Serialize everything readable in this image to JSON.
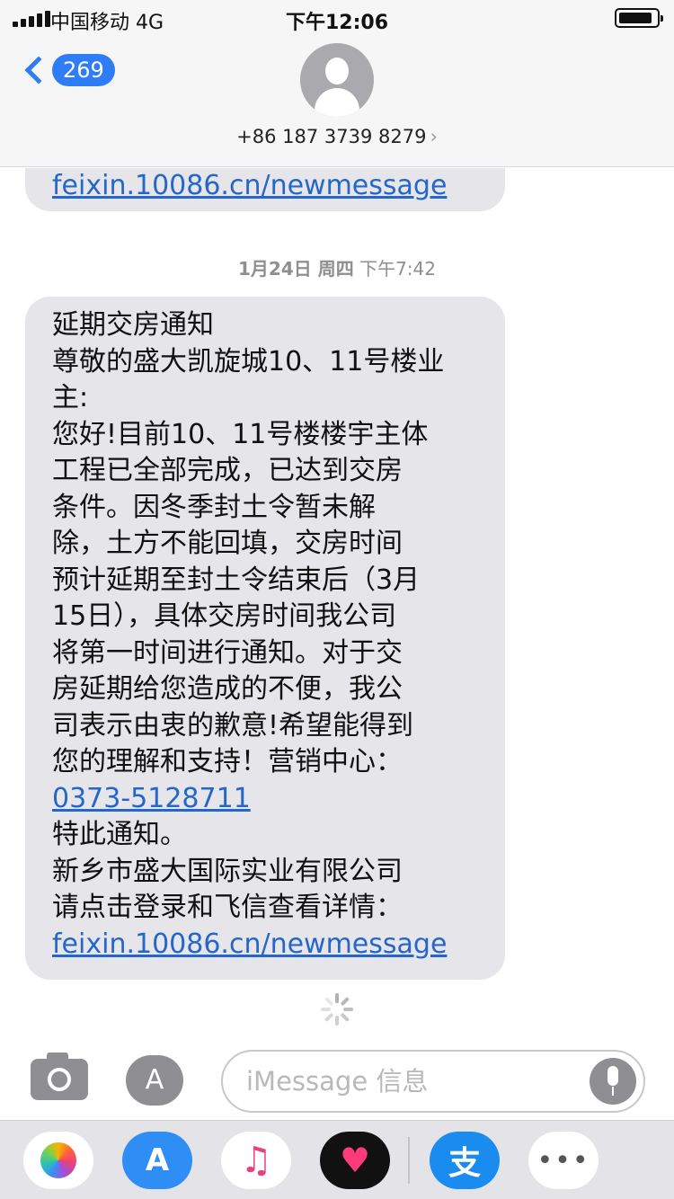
{
  "status_bar": {
    "carrier": "中国移动  4G",
    "time": "下午12:06"
  },
  "header": {
    "back_count": "269",
    "contact": "+86 187 3739 8279",
    "contact_chevron": "›"
  },
  "messages": {
    "previous_link": "feixin.10086.cn/newmessage",
    "timestamp_date": "1月24日 周四",
    "timestamp_time": "下午7:42",
    "body_lines": [
      "延期交房通知",
      "尊敬的盛大凯旋城10、11号楼业",
      "主:",
      "您好!目前10、11号楼楼宇主体",
      "工程已全部完成，已达到交房",
      "条件。因冬季封土令暂未解",
      "除，土方不能回填，交房时间",
      "预计延期至封土令结束后（3月",
      "15日），具体交房时间我公司",
      "将第一时间进行通知。对于交",
      "房延期给您造成的不便，我公",
      "司表示由衷的歉意!希望能得到",
      "您的理解和支持！营销中心："
    ],
    "phone_link": "0373-5128711",
    "closing_lines": [
      "特此通知。",
      "新乡市盛大国际实业有限公司",
      "请点击登录和飞信查看详情："
    ],
    "footer_link": "feixin.10086.cn/newmessage"
  },
  "input_bar": {
    "placeholder": "iMessage 信息",
    "appstore_glyph": "A"
  },
  "app_drawer": {
    "apps": [
      {
        "name": "photos-icon"
      },
      {
        "name": "app-store-icon",
        "glyph": "A"
      },
      {
        "name": "music-icon",
        "glyph": "♫"
      },
      {
        "name": "digital-touch-icon",
        "glyph": "♥"
      },
      {
        "name": "alipay-icon",
        "glyph": "支"
      },
      {
        "name": "more-icon",
        "glyph": "•••"
      }
    ]
  },
  "colors": {
    "accent": "#2f7df6",
    "bubble": "#e5e5ea",
    "link": "#2567c8"
  }
}
